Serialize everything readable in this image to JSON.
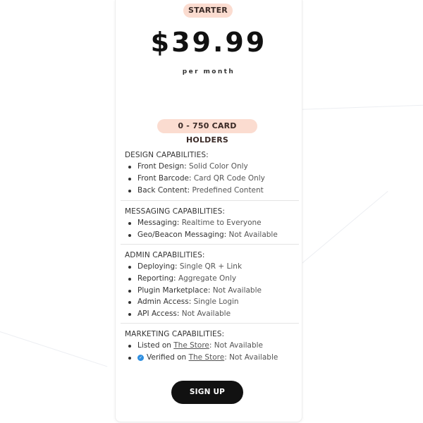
{
  "plan": {
    "name": "STARTER",
    "price": "$39.99",
    "period": "per month",
    "holders": "0 - 750 CARD HOLDERS"
  },
  "sections": [
    {
      "title": "DESIGN CAPABILITIES:",
      "items": [
        {
          "label": "Front Design:",
          "value": "Solid Color Only"
        },
        {
          "label": "Front Barcode:",
          "value": "Card QR Code Only"
        },
        {
          "label": "Back Content:",
          "value": "Predefined Content"
        }
      ]
    },
    {
      "title": "MESSAGING CAPABILITIES:",
      "items": [
        {
          "label": "Messaging:",
          "value": "Realtime to Everyone"
        },
        {
          "label": "Geo/Beacon Messaging:",
          "value": "Not Available"
        }
      ]
    },
    {
      "title": "ADMIN CAPABILITIES:",
      "items": [
        {
          "label": "Deploying:",
          "value": "Single QR + Link"
        },
        {
          "label": "Reporting:",
          "value": "Aggregate Only"
        },
        {
          "label": "Plugin Marketplace:",
          "value": "Not Available"
        },
        {
          "label": "Admin Access:",
          "value": "Single Login"
        },
        {
          "label": "API Access:",
          "value": "Not Available"
        }
      ]
    },
    {
      "title": "MARKETING CAPABILITIES:",
      "items": [
        {
          "label": "Listed on",
          "link": "The Store",
          "value": ": Not Available"
        },
        {
          "label": "Verified on",
          "link": "The Store",
          "value": ": Not Available"
        }
      ]
    }
  ],
  "cta": {
    "label": "SIGN UP"
  },
  "colors": {
    "accent_pill": "#fbdcd0",
    "button": "#111111",
    "verified_check": "#2f8fe0"
  }
}
